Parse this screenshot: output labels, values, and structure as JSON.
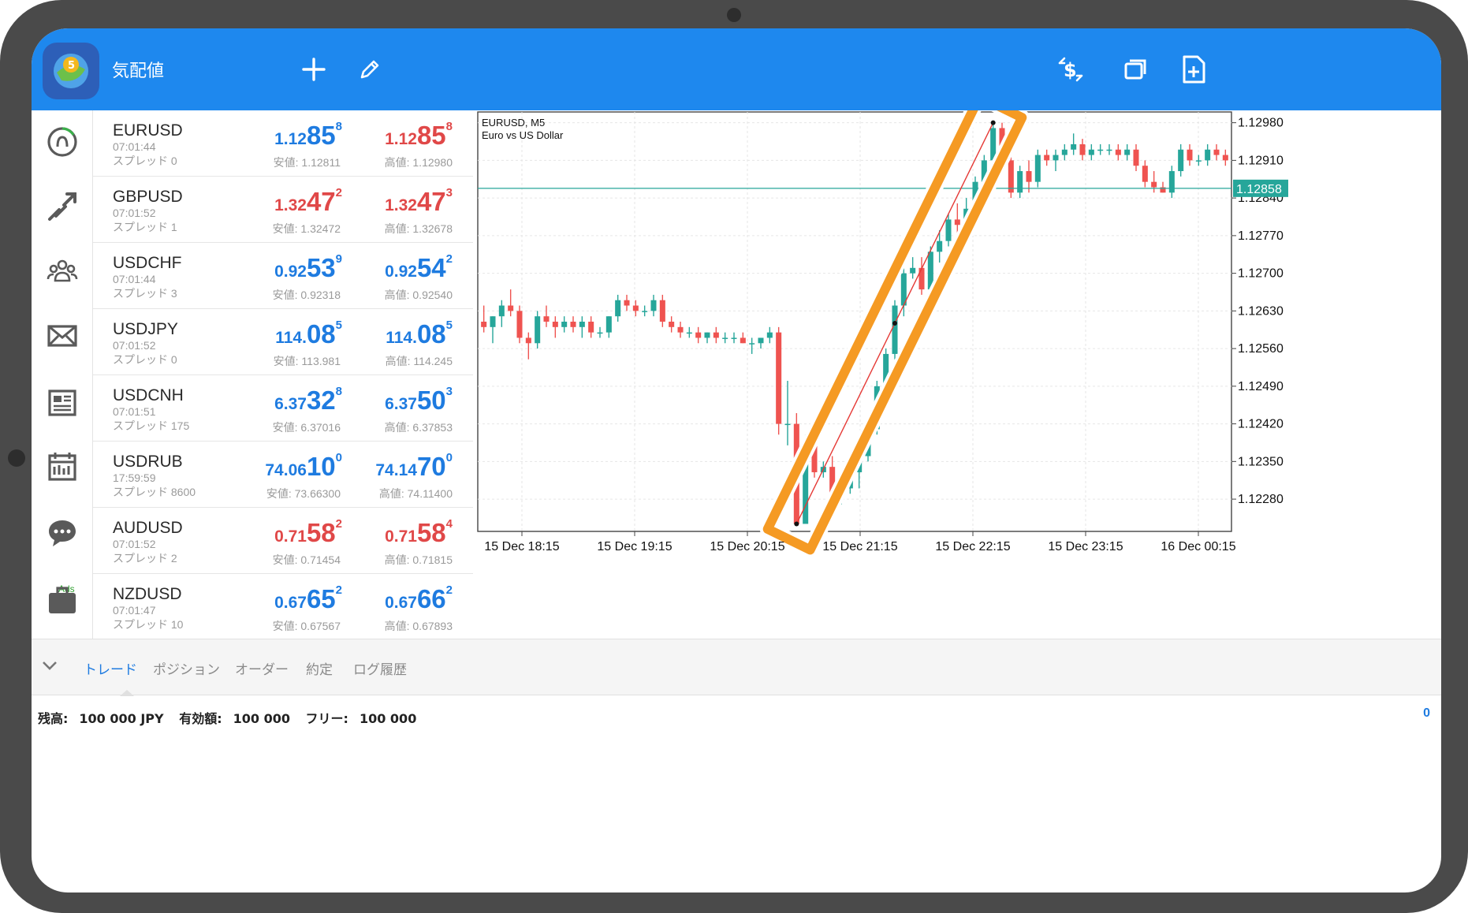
{
  "app": {
    "title": "気配値",
    "icons": [
      "metatrader-logo",
      "plus-icon",
      "pencil-icon",
      "currency-exchange-icon",
      "window-icon",
      "add-document-icon"
    ]
  },
  "nav": {
    "icons": [
      "quotes-icon",
      "chart-arrow-icon",
      "community-icon",
      "mail-icon",
      "news-icon",
      "calendar-icon",
      "chat-icon",
      "briefcase-icon"
    ],
    "ads_label": "Ads"
  },
  "quotes": [
    {
      "symbol": "EURUSD",
      "time": "07:01:44",
      "spread": "スプレッド 0",
      "bid": {
        "small": "1.12",
        "big": "85",
        "sup": "8",
        "color": "#1e7be0"
      },
      "ask": {
        "small": "1.12",
        "big": "85",
        "sup": "8",
        "color": "#e04848"
      },
      "low": "安値: 1.12811",
      "high": "高値: 1.12980"
    },
    {
      "symbol": "GBPUSD",
      "time": "07:01:52",
      "spread": "スプレッド 1",
      "bid": {
        "small": "1.32",
        "big": "47",
        "sup": "2",
        "color": "#e04848"
      },
      "ask": {
        "small": "1.32",
        "big": "47",
        "sup": "3",
        "color": "#e04848"
      },
      "low": "安値: 1.32472",
      "high": "高値: 1.32678"
    },
    {
      "symbol": "USDCHF",
      "time": "07:01:44",
      "spread": "スプレッド 3",
      "bid": {
        "small": "0.92",
        "big": "53",
        "sup": "9",
        "color": "#1e7be0"
      },
      "ask": {
        "small": "0.92",
        "big": "54",
        "sup": "2",
        "color": "#1e7be0"
      },
      "low": "安値: 0.92318",
      "high": "高値: 0.92540"
    },
    {
      "symbol": "USDJPY",
      "time": "07:01:52",
      "spread": "スプレッド 0",
      "bid": {
        "small": "114.",
        "big": "08",
        "sup": "5",
        "color": "#1e7be0"
      },
      "ask": {
        "small": "114.",
        "big": "08",
        "sup": "5",
        "color": "#1e7be0"
      },
      "low": "安値: 113.981",
      "high": "高値: 114.245"
    },
    {
      "symbol": "USDCNH",
      "time": "07:01:51",
      "spread": "スプレッド 175",
      "bid": {
        "small": "6.37",
        "big": "32",
        "sup": "8",
        "color": "#1e7be0"
      },
      "ask": {
        "small": "6.37",
        "big": "50",
        "sup": "3",
        "color": "#1e7be0"
      },
      "low": "安値: 6.37016",
      "high": "高値: 6.37853"
    },
    {
      "symbol": "USDRUB",
      "time": "17:59:59",
      "spread": "スプレッド 8600",
      "bid": {
        "small": "74.06",
        "big": "10",
        "sup": "0",
        "color": "#1e7be0"
      },
      "ask": {
        "small": "74.14",
        "big": "70",
        "sup": "0",
        "color": "#1e7be0"
      },
      "low": "安値: 73.66300",
      "high": "高値: 74.11400"
    },
    {
      "symbol": "AUDUSD",
      "time": "07:01:52",
      "spread": "スプレッド 2",
      "bid": {
        "small": "0.71",
        "big": "58",
        "sup": "2",
        "color": "#e04848"
      },
      "ask": {
        "small": "0.71",
        "big": "58",
        "sup": "4",
        "color": "#e04848"
      },
      "low": "安値: 0.71454",
      "high": "高値: 0.71815"
    },
    {
      "symbol": "NZDUSD",
      "time": "07:01:47",
      "spread": "スプレッド 10",
      "bid": {
        "small": "0.67",
        "big": "65",
        "sup": "2",
        "color": "#1e7be0"
      },
      "ask": {
        "small": "0.67",
        "big": "66",
        "sup": "2",
        "color": "#1e7be0"
      },
      "low": "安値: 0.67567",
      "high": "高値: 0.67893"
    }
  ],
  "chart_data": {
    "type": "candlestick",
    "title": "EURUSD, M5",
    "subtitle": "Euro vs US Dollar",
    "ylim": [
      1.1222,
      1.13
    ],
    "yticks": [
      1.1298,
      1.1291,
      1.1284,
      1.1277,
      1.127,
      1.1263,
      1.1256,
      1.1249,
      1.1242,
      1.1235,
      1.1228
    ],
    "ytick_labels": [
      "1.12980",
      "1.12910",
      "1.12840",
      "1.12770",
      "1.12700",
      "1.12630",
      "1.12560",
      "1.12490",
      "1.12420",
      "1.12350",
      "1.12280"
    ],
    "xtick_labels": [
      "15 Dec 18:15",
      "15 Dec 19:15",
      "15 Dec 20:15",
      "15 Dec 21:15",
      "15 Dec 22:15",
      "15 Dec 23:15",
      "16 Dec 00:15"
    ],
    "current_price": 1.12858,
    "current_price_label": "1.12858",
    "up_color": "#26a69a",
    "down_color": "#ef5350",
    "trendline": {
      "from": [
        1.12234,
        1.12234
      ],
      "to": [
        1.1298,
        1.1298
      ],
      "color": "#e53935"
    },
    "highlight_color": "#f59a23",
    "candles": [
      [
        1.1261,
        1.1264,
        1.1259,
        1.126
      ],
      [
        1.126,
        1.1262,
        1.1257,
        1.1262
      ],
      [
        1.1262,
        1.1265,
        1.126,
        1.1264
      ],
      [
        1.1264,
        1.1267,
        1.1262,
        1.1263
      ],
      [
        1.1263,
        1.1264,
        1.1257,
        1.1258
      ],
      [
        1.1258,
        1.1259,
        1.1254,
        1.1257
      ],
      [
        1.1257,
        1.1263,
        1.1256,
        1.1262
      ],
      [
        1.1262,
        1.1264,
        1.126,
        1.1261
      ],
      [
        1.1261,
        1.1262,
        1.1258,
        1.126
      ],
      [
        1.126,
        1.1262,
        1.1259,
        1.1261
      ],
      [
        1.1261,
        1.1262,
        1.1259,
        1.126
      ],
      [
        1.126,
        1.1262,
        1.1258,
        1.1261
      ],
      [
        1.1261,
        1.1262,
        1.1258,
        1.1259
      ],
      [
        1.1259,
        1.126,
        1.1258,
        1.1259
      ],
      [
        1.1259,
        1.1262,
        1.1258,
        1.1262
      ],
      [
        1.1262,
        1.1266,
        1.1261,
        1.1265
      ],
      [
        1.1265,
        1.1266,
        1.1263,
        1.1264
      ],
      [
        1.1264,
        1.1265,
        1.1262,
        1.1263
      ],
      [
        1.1263,
        1.1264,
        1.1262,
        1.1263
      ],
      [
        1.1263,
        1.1266,
        1.1262,
        1.1265
      ],
      [
        1.1265,
        1.1266,
        1.126,
        1.1261
      ],
      [
        1.1261,
        1.1262,
        1.1259,
        1.126
      ],
      [
        1.126,
        1.1261,
        1.1258,
        1.1259
      ],
      [
        1.1259,
        1.126,
        1.1258,
        1.1259
      ],
      [
        1.1259,
        1.126,
        1.1257,
        1.1258
      ],
      [
        1.1258,
        1.1259,
        1.1257,
        1.1259
      ],
      [
        1.1259,
        1.126,
        1.1257,
        1.1258
      ],
      [
        1.1258,
        1.1259,
        1.1257,
        1.1258
      ],
      [
        1.1258,
        1.1259,
        1.1257,
        1.1258
      ],
      [
        1.1258,
        1.1259,
        1.1257,
        1.1257
      ],
      [
        1.1257,
        1.1258,
        1.1255,
        1.1257
      ],
      [
        1.1257,
        1.1258,
        1.1256,
        1.1258
      ],
      [
        1.1258,
        1.126,
        1.1257,
        1.1259
      ],
      [
        1.1259,
        1.126,
        1.124,
        1.1242
      ],
      [
        1.1242,
        1.125,
        1.1238,
        1.1242
      ],
      [
        1.1242,
        1.1244,
        1.12234,
        1.12234
      ],
      [
        1.12234,
        1.124,
        1.123,
        1.1238
      ],
      [
        1.1238,
        1.124,
        1.1232,
        1.1233
      ],
      [
        1.1233,
        1.1235,
        1.1232,
        1.1234
      ],
      [
        1.1234,
        1.1236,
        1.123,
        1.1229
      ],
      [
        1.1229,
        1.1232,
        1.1227,
        1.123
      ],
      [
        1.123,
        1.1234,
        1.1229,
        1.1233
      ],
      [
        1.1233,
        1.1237,
        1.123,
        1.1236
      ],
      [
        1.1236,
        1.1242,
        1.1235,
        1.1241
      ],
      [
        1.1241,
        1.125,
        1.124,
        1.1249
      ],
      [
        1.1249,
        1.1256,
        1.1247,
        1.1255
      ],
      [
        1.1255,
        1.1265,
        1.1254,
        1.1264
      ],
      [
        1.1264,
        1.1271,
        1.1262,
        1.127
      ],
      [
        1.127,
        1.1273,
        1.1269,
        1.1271
      ],
      [
        1.1271,
        1.1273,
        1.1266,
        1.1267
      ],
      [
        1.1267,
        1.1275,
        1.1266,
        1.1274
      ],
      [
        1.1274,
        1.1278,
        1.1272,
        1.1276
      ],
      [
        1.1276,
        1.1281,
        1.1275,
        1.128
      ],
      [
        1.128,
        1.1283,
        1.1277,
        1.1279
      ],
      [
        1.1279,
        1.1284,
        1.1278,
        1.1282
      ],
      [
        1.1282,
        1.1288,
        1.1281,
        1.1287
      ],
      [
        1.1287,
        1.1292,
        1.1286,
        1.1291
      ],
      [
        1.1291,
        1.1298,
        1.129,
        1.1297
      ],
      [
        1.1297,
        1.1298,
        1.129,
        1.1291
      ],
      [
        1.1291,
        1.1292,
        1.1284,
        1.1285
      ],
      [
        1.1285,
        1.129,
        1.1284,
        1.1289
      ],
      [
        1.1289,
        1.1291,
        1.1285,
        1.1287
      ],
      [
        1.1287,
        1.1293,
        1.1286,
        1.1292
      ],
      [
        1.1292,
        1.1293,
        1.129,
        1.1291
      ],
      [
        1.1291,
        1.1293,
        1.1289,
        1.1292
      ],
      [
        1.1292,
        1.1294,
        1.1291,
        1.1293
      ],
      [
        1.1293,
        1.1296,
        1.1292,
        1.1294
      ],
      [
        1.1294,
        1.1295,
        1.1291,
        1.1292
      ],
      [
        1.1292,
        1.1294,
        1.1291,
        1.1293
      ],
      [
        1.1293,
        1.1294,
        1.1292,
        1.1293
      ],
      [
        1.1293,
        1.1294,
        1.1292,
        1.1293
      ],
      [
        1.1293,
        1.1294,
        1.1291,
        1.1292
      ],
      [
        1.1292,
        1.1294,
        1.1291,
        1.1293
      ],
      [
        1.1293,
        1.1294,
        1.1289,
        1.129
      ],
      [
        1.129,
        1.1291,
        1.1286,
        1.1287
      ],
      [
        1.1287,
        1.1289,
        1.1285,
        1.1286
      ],
      [
        1.1286,
        1.1287,
        1.1285,
        1.1285
      ],
      [
        1.1285,
        1.129,
        1.1284,
        1.1289
      ],
      [
        1.1289,
        1.1294,
        1.1288,
        1.1293
      ],
      [
        1.1293,
        1.1294,
        1.129,
        1.1291
      ],
      [
        1.1291,
        1.1292,
        1.129,
        1.1291
      ],
      [
        1.1291,
        1.1294,
        1.129,
        1.1293
      ],
      [
        1.1293,
        1.1294,
        1.1291,
        1.1292
      ],
      [
        1.1292,
        1.1293,
        1.129,
        1.1291
      ]
    ]
  },
  "tabs": {
    "items": [
      "トレード",
      "ポジション",
      "オーダー",
      "約定",
      "ログ履歴"
    ],
    "active": 0,
    "chevron": "chevron-down-icon"
  },
  "account": {
    "balance_label": "残高:",
    "balance_value": "100 000 JPY",
    "equity_label": "有効額:",
    "equity_value": "100 000",
    "free_label": "フリー:",
    "free_value": "100 000",
    "profit": "0"
  }
}
